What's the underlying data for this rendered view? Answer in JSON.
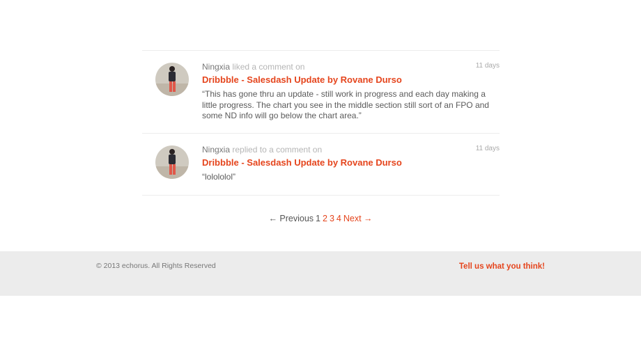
{
  "activities": [
    {
      "user": "Ningxia",
      "verb": "liked a comment on",
      "time": "11 days",
      "title": "Dribbble - Salesdash Update by Rovane Durso",
      "quote": "“This has gone thru an update - still work in progress and each day making a little progress. The chart you see in the middle section still sort of an FPO and some ND info will go below the chart area.”"
    },
    {
      "user": "Ningxia",
      "verb": "replied to a comment on",
      "time": "11 days",
      "title": "Dribbble - Salesdash Update by Rovane Durso",
      "quote": "“lolololol”"
    }
  ],
  "pagination": {
    "previous": "← Previous",
    "pages": [
      "1",
      "2",
      "3",
      "4"
    ],
    "current": "1",
    "next": "Next →"
  },
  "footer": {
    "copyright": "© 2013 echorus. All Rights Reserved",
    "feedback": "Tell us what you think!"
  },
  "colors": {
    "accent": "#e5451d",
    "footer_bg": "#ececec"
  }
}
